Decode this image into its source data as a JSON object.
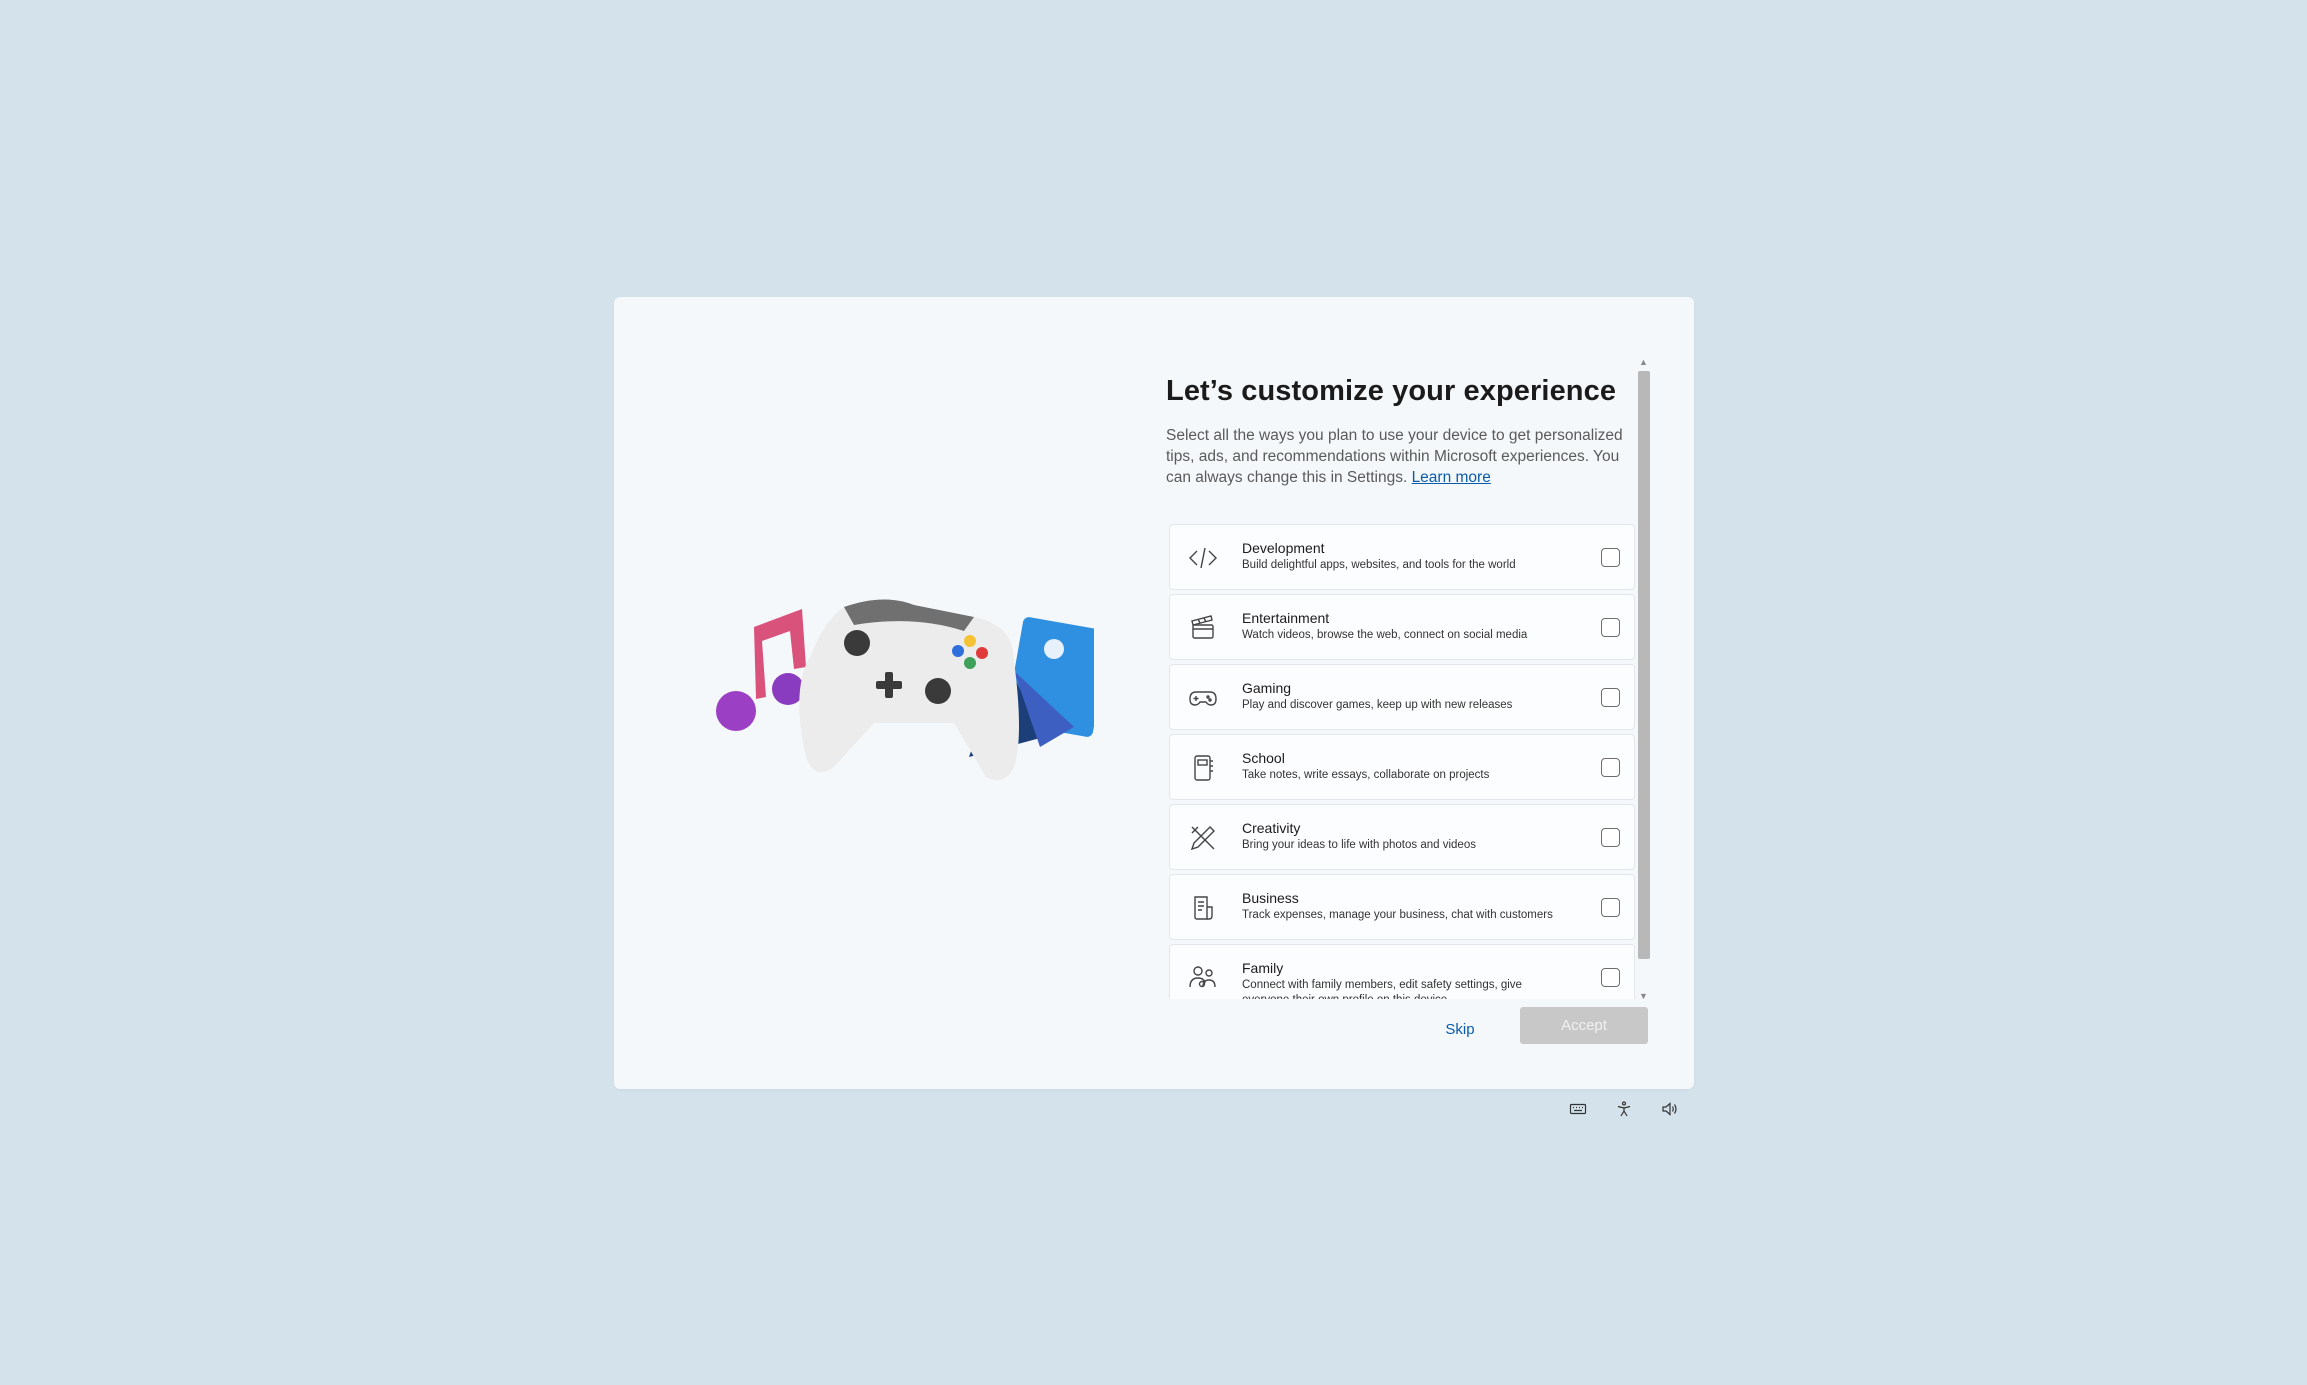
{
  "page": {
    "title": "Let’s customize your experience",
    "description": "Select all the ways you plan to use your device to get personalized tips, ads, and recommendations within Microsoft experiences. You can always change this in Settings. ",
    "learn_more": "Learn more"
  },
  "options": [
    {
      "icon": "code-icon",
      "label": "Development",
      "description": "Build delightful apps, websites, and tools for the world",
      "checked": false
    },
    {
      "icon": "clapperboard-icon",
      "label": "Entertainment",
      "description": "Watch videos, browse the web, connect on social media",
      "checked": false
    },
    {
      "icon": "gamepad-icon",
      "label": "Gaming",
      "description": "Play and discover games, keep up with new releases",
      "checked": false
    },
    {
      "icon": "notebook-icon",
      "label": "School",
      "description": "Take notes, write essays, collaborate on projects",
      "checked": false
    },
    {
      "icon": "pen-ruler-icon",
      "label": "Creativity",
      "description": "Bring your ideas to life with photos and videos",
      "checked": false
    },
    {
      "icon": "receipt-icon",
      "label": "Business",
      "description": "Track expenses, manage your business, chat with customers",
      "checked": false
    },
    {
      "icon": "people-icon",
      "label": "Family",
      "description": "Connect with family members, edit safety settings, give everyone their own profile on this device",
      "checked": false
    }
  ],
  "buttons": {
    "skip": "Skip",
    "accept": "Accept"
  },
  "colors": {
    "background": "#d4e2ec",
    "dialog": "#f5f8fb",
    "link": "#0a5ca8",
    "accept_disabled": "#c8c8c8"
  },
  "tray_icons": [
    "keyboard-icon",
    "accessibility-icon",
    "volume-icon"
  ]
}
